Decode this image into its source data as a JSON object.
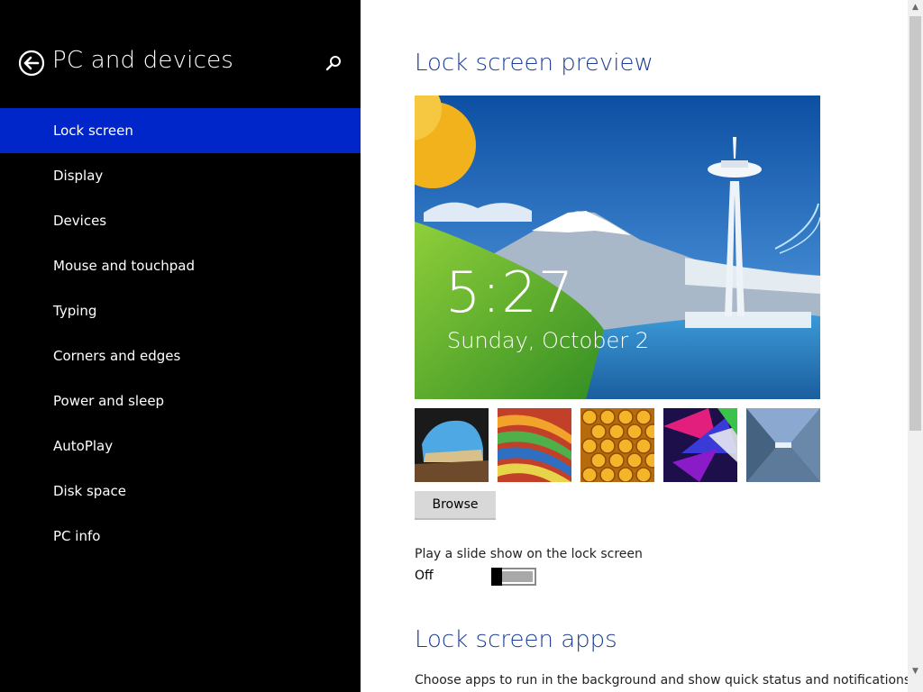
{
  "sidebar": {
    "title": "PC and devices",
    "back_icon": "back-arrow-icon",
    "search_icon": "search-icon",
    "items": [
      {
        "label": "Lock screen",
        "selected": true
      },
      {
        "label": "Display"
      },
      {
        "label": "Devices"
      },
      {
        "label": "Mouse and touchpad"
      },
      {
        "label": "Typing"
      },
      {
        "label": "Corners and edges"
      },
      {
        "label": "Power and sleep"
      },
      {
        "label": "AutoPlay"
      },
      {
        "label": "Disk space"
      },
      {
        "label": "PC info"
      }
    ]
  },
  "main": {
    "preview_heading": "Lock screen preview",
    "preview": {
      "time": "5:27",
      "date": "Sunday, October 2"
    },
    "browse_label": "Browse",
    "slideshow": {
      "label": "Play a slide show on the lock screen",
      "state": "Off",
      "on": false
    },
    "apps_heading": "Lock screen apps",
    "apps_description": "Choose apps to run in the background and show quick status and notifications,"
  },
  "colors": {
    "sidebar_bg": "#000000",
    "selected_bg": "#0026c9",
    "heading": "#1e3f95"
  }
}
